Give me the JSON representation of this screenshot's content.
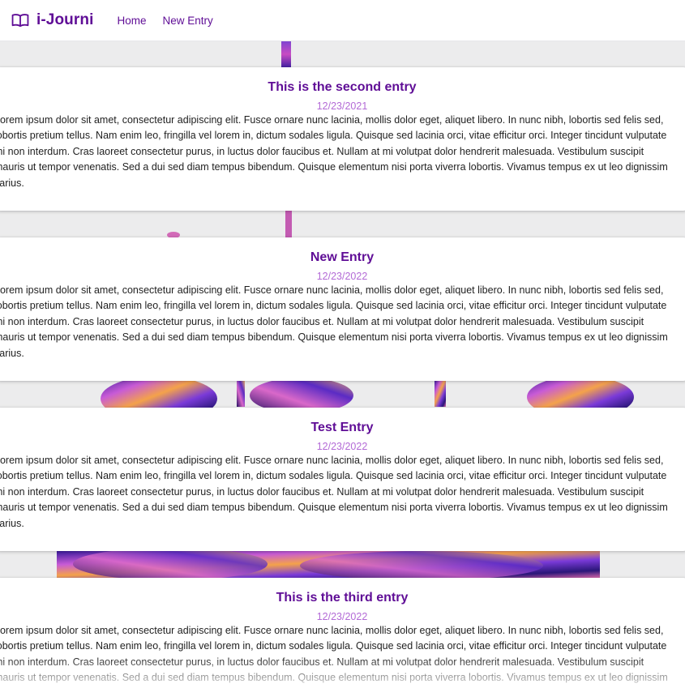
{
  "navbar": {
    "brand": "i-Journi",
    "brand_icon": "book-open-icon",
    "links": [
      "Home",
      "New Entry"
    ]
  },
  "colors": {
    "brand": "#5f0d96",
    "date": "#b36ad6",
    "background": "#ececed"
  },
  "entries": [
    {
      "title": "This is the second entry",
      "date": "12/23/2021",
      "body": "Lorem ipsum dolor sit amet, consectetur adipiscing elit. Fusce ornare nunc lacinia, mollis dolor eget, aliquet libero. In nunc nibh, lobortis sed felis sed, lobortis pretium tellus. Nam enim leo, fringilla vel lorem in, dictum sodales ligula. Quisque sed lacinia orci, vitae efficitur orci. Integer tincidunt vulputate mi non interdum. Cras laoreet consectetur purus, in luctus dolor faucibus et. Nullam at mi volutpat dolor hendrerit malesuada. Vestibulum suscipit mauris ut tempor venenatis. Sed a dui sed diam tempus bibendum. Quisque elementum nisi porta viverra lobortis. Vivamus tempus ex ut leo dignissim varius."
    },
    {
      "title": "New Entry",
      "date": "12/23/2022",
      "body": "Lorem ipsum dolor sit amet, consectetur adipiscing elit. Fusce ornare nunc lacinia, mollis dolor eget, aliquet libero. In nunc nibh, lobortis sed felis sed, lobortis pretium tellus. Nam enim leo, fringilla vel lorem in, dictum sodales ligula. Quisque sed lacinia orci, vitae efficitur orci. Integer tincidunt vulputate mi non interdum. Cras laoreet consectetur purus, in luctus dolor faucibus et. Nullam at mi volutpat dolor hendrerit malesuada. Vestibulum suscipit mauris ut tempor venenatis. Sed a dui sed diam tempus bibendum. Quisque elementum nisi porta viverra lobortis. Vivamus tempus ex ut leo dignissim varius."
    },
    {
      "title": "Test Entry",
      "date": "12/23/2022",
      "body": "Lorem ipsum dolor sit amet, consectetur adipiscing elit. Fusce ornare nunc lacinia, mollis dolor eget, aliquet libero. In nunc nibh, lobortis sed felis sed, lobortis pretium tellus. Nam enim leo, fringilla vel lorem in, dictum sodales ligula. Quisque sed lacinia orci, vitae efficitur orci. Integer tincidunt vulputate mi non interdum. Cras laoreet consectetur purus, in luctus dolor faucibus et. Nullam at mi volutpat dolor hendrerit malesuada. Vestibulum suscipit mauris ut tempor venenatis. Sed a dui sed diam tempus bibendum. Quisque elementum nisi porta viverra lobortis. Vivamus tempus ex ut leo dignissim varius."
    },
    {
      "title": "This is the third entry",
      "date": "12/23/2022",
      "body": "Lorem ipsum dolor sit amet, consectetur adipiscing elit. Fusce ornare nunc lacinia, mollis dolor eget, aliquet libero. In nunc nibh, lobortis sed felis sed, lobortis pretium tellus. Nam enim leo, fringilla vel lorem in, dictum sodales ligula. Quisque sed lacinia orci, vitae efficitur orci. Integer tincidunt vulputate mi non interdum. Cras laoreet consectetur purus, in luctus dolor faucibus et. Nullam at mi volutpat dolor hendrerit malesuada. Vestibulum suscipit mauris ut tempor venenatis. Sed a dui sed diam tempus bibendum. Quisque elementum nisi porta viverra lobortis. Vivamus tempus ex ut leo dignissim varius."
    }
  ]
}
